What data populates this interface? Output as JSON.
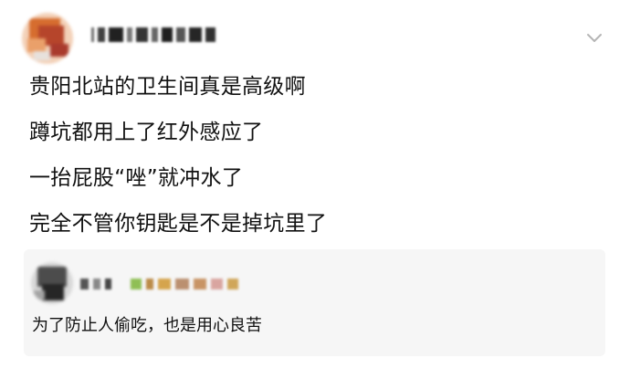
{
  "post": {
    "lines": [
      "贵阳北站的卫生间真是高级啊",
      "蹲坑都用上了红外感应了",
      "一抬屁股“唑”就冲水了",
      "完全不管你钥匙是不是掉坑里了"
    ]
  },
  "reply": {
    "text": "为了防止人偷吃，也是用心良苦"
  },
  "icons": {
    "avatar": "blurred-profile-avatar",
    "menu": "chevron-down-icon",
    "reply_avatar": "blurred-profile-avatar"
  },
  "colors": {
    "text": "#111111",
    "reply_background": "#f6f6f6",
    "chevron": "#b5b5b5"
  }
}
